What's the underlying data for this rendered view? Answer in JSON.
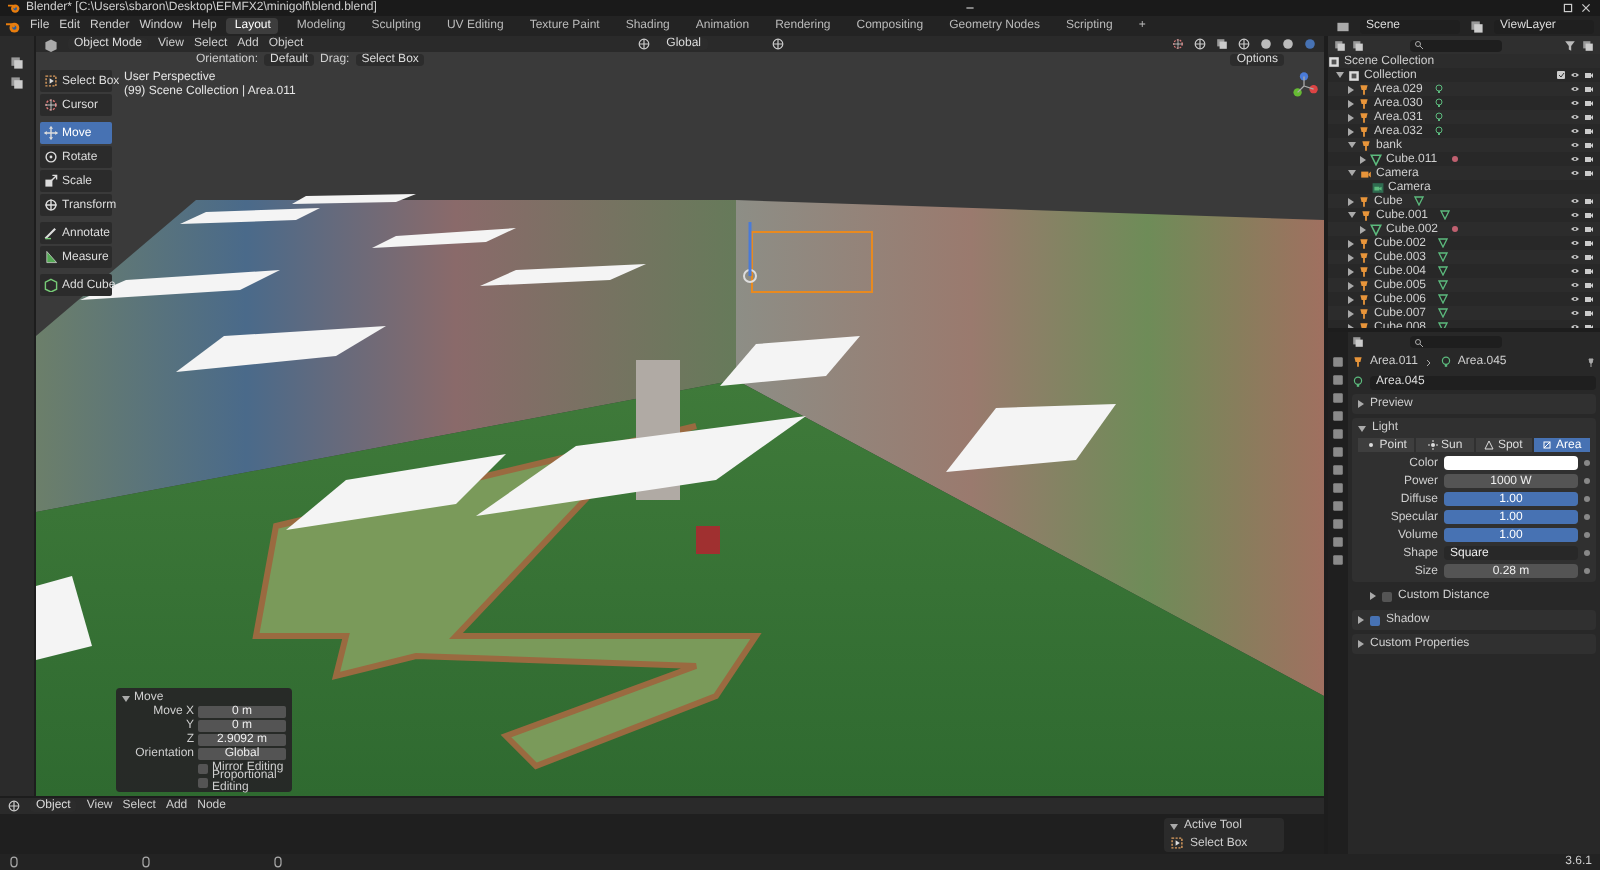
{
  "window": {
    "title": "Blender* [C:\\Users\\sbaron\\Desktop\\EFMFX2\\minigolf\\blend.blend]"
  },
  "menu": [
    "File",
    "Edit",
    "Render",
    "Window",
    "Help"
  ],
  "workspaces": [
    {
      "label": "Layout",
      "selected": true
    },
    {
      "label": "Modeling",
      "selected": false
    },
    {
      "label": "Sculpting",
      "selected": false
    },
    {
      "label": "UV Editing",
      "selected": false
    },
    {
      "label": "Texture Paint",
      "selected": false
    },
    {
      "label": "Shading",
      "selected": false
    },
    {
      "label": "Animation",
      "selected": false
    },
    {
      "label": "Rendering",
      "selected": false
    },
    {
      "label": "Compositing",
      "selected": false
    },
    {
      "label": "Geometry Nodes",
      "selected": false
    },
    {
      "label": "Scripting",
      "selected": false
    },
    {
      "label": "+",
      "selected": false
    }
  ],
  "scene": "Scene",
  "view_layer": "ViewLayer",
  "viewport": {
    "mode": "Object Mode",
    "menus": [
      "View",
      "Select",
      "Add",
      "Object"
    ],
    "transform": "Global",
    "options": "Options",
    "orientation_label": "Orientation:",
    "orientation": "Default",
    "drag_label": "Drag:",
    "drag": "Select Box",
    "tool_groups": [
      [
        {
          "label": "Select Box",
          "selected": false
        },
        {
          "label": "Cursor",
          "selected": false
        }
      ],
      [
        {
          "label": "Move",
          "selected": true
        },
        {
          "label": "Rotate",
          "selected": false
        },
        {
          "label": "Scale",
          "selected": false
        },
        {
          "label": "Transform",
          "selected": false
        }
      ],
      [
        {
          "label": "Annotate",
          "selected": false
        },
        {
          "label": "Measure",
          "selected": false
        }
      ],
      [
        {
          "label": "Add Cube",
          "selected": false
        }
      ]
    ],
    "overlay": [
      "User Perspective",
      "(99) Scene Collection | Area.011"
    ],
    "operator_panel": {
      "title": "Move",
      "fields": [
        {
          "label": "Move X",
          "value": "0 m"
        },
        {
          "label": "Y",
          "value": "0 m"
        },
        {
          "label": "Z",
          "value": "2.9092 m"
        }
      ],
      "orientation_label": "Orientation",
      "orientation": "Global",
      "options": [
        {
          "label": "Mirror Editing",
          "checked": false
        },
        {
          "label": "Proportional Editing",
          "checked": false
        }
      ]
    }
  },
  "outliner": {
    "root": "Scene Collection",
    "items": [
      {
        "name": "Collection",
        "kind": "collection",
        "expanded": true,
        "children": [
          {
            "name": "Area.029",
            "kind": "light",
            "expanded": false
          },
          {
            "name": "Area.030",
            "kind": "light",
            "expanded": false
          },
          {
            "name": "Area.031",
            "kind": "light",
            "expanded": false
          },
          {
            "name": "Area.032",
            "kind": "light",
            "expanded": false
          },
          {
            "name": "bank",
            "kind": "empty",
            "expanded": true,
            "children": [
              {
                "name": "Cube.011",
                "kind": "mesh_child",
                "expanded": false
              }
            ]
          },
          {
            "name": "Camera",
            "kind": "camera",
            "expanded": true,
            "children": [
              {
                "name": "Camera",
                "kind": "camera_data"
              }
            ]
          },
          {
            "name": "Cube",
            "kind": "mesh",
            "expanded": false
          },
          {
            "name": "Cube.001",
            "kind": "mesh",
            "expanded": true,
            "children": [
              {
                "name": "Cube.002",
                "kind": "mesh_child",
                "expanded": false
              }
            ]
          },
          {
            "name": "Cube.002",
            "kind": "mesh",
            "expanded": false
          },
          {
            "name": "Cube.003",
            "kind": "mesh",
            "expanded": false
          },
          {
            "name": "Cube.004",
            "kind": "mesh",
            "expanded": false
          },
          {
            "name": "Cube.005",
            "kind": "mesh",
            "expanded": false
          },
          {
            "name": "Cube.006",
            "kind": "mesh",
            "expanded": false
          },
          {
            "name": "Cube.007",
            "kind": "mesh",
            "expanded": false
          },
          {
            "name": "Cube.008",
            "kind": "mesh",
            "expanded": false
          }
        ]
      }
    ]
  },
  "properties": {
    "breadcrumb": [
      "Area.011",
      "Area.045"
    ],
    "data_name": "Area.045",
    "sections": [
      {
        "kind": "panel",
        "title": "Preview",
        "expanded": false
      },
      {
        "kind": "light",
        "title": "Light",
        "expanded": true
      },
      {
        "kind": "subpanel",
        "title": "Custom Distance",
        "expanded": false,
        "checked": false
      },
      {
        "kind": "panel",
        "title": "Shadow",
        "expanded": false,
        "checked": true
      },
      {
        "kind": "panel",
        "title": "Custom Properties",
        "expanded": false
      }
    ],
    "light_types": [
      {
        "label": "Point",
        "selected": false
      },
      {
        "label": "Sun",
        "selected": false
      },
      {
        "label": "Spot",
        "selected": false
      },
      {
        "label": "Area",
        "selected": true
      }
    ],
    "fields": [
      {
        "kind": "color",
        "label": "Color",
        "color": "#ffffff"
      },
      {
        "kind": "number",
        "label": "Power",
        "value": "1000 W"
      },
      {
        "kind": "slider",
        "label": "Diffuse",
        "value": "1.00",
        "level": 1
      },
      {
        "kind": "slider",
        "label": "Specular",
        "value": "1.00",
        "level": 1
      },
      {
        "kind": "slider",
        "label": "Volume",
        "value": "1.00",
        "level": 1
      },
      {
        "kind": "dropdown",
        "label": "Shape",
        "value": "Square"
      },
      {
        "kind": "number",
        "label": "Size",
        "value": "0.28 m"
      }
    ]
  },
  "timeline": {
    "mode": "Object",
    "menus": [
      "View",
      "Select",
      "Add",
      "Node"
    ]
  },
  "active_tool": {
    "title": "Active Tool",
    "tool": "Select Box"
  },
  "status_bar": {
    "version": "3.6.1"
  }
}
